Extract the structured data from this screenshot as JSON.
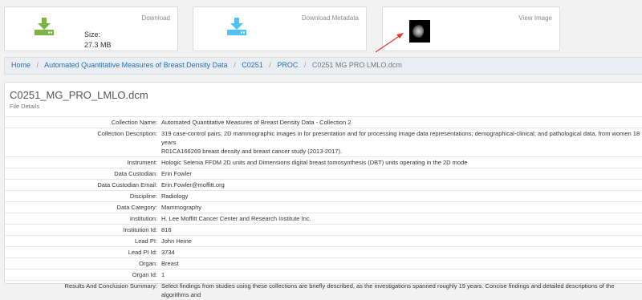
{
  "cards": {
    "download": {
      "caption": "Download",
      "size_label": "Size:",
      "size_value": "27.3 MB"
    },
    "metadata": {
      "caption": "Download Metadata"
    },
    "view": {
      "caption": "View Image"
    }
  },
  "icons": {
    "download_color": "#7cb342",
    "metadata_color": "#4fc3f7",
    "arrow_color": "#e53935"
  },
  "breadcrumb": {
    "home": "Home",
    "collection": "Automated Quantitative Measures of Breast Density Data",
    "subject": "C0251",
    "study": "PROC",
    "current": "C0251 MG PRO LMLO.dcm"
  },
  "file": {
    "title": "C0251_MG_PRO_LMLO.dcm",
    "subtitle": "File Details"
  },
  "details": [
    {
      "label": "Collection Name:",
      "value": "Automated Quantitative Measures of Breast Density Data - Collection 2"
    },
    {
      "label": "Collection Description:",
      "value": "319 case-control pairs; 2D mammographic images in for presentation and for processing image data representations; demographical-clinical; and pathological data, from women 18 years\nR01CA166269 breast density and breast cancer study (2013-2017)."
    },
    {
      "label": "Instrument:",
      "value": "Hologic Selenia FFDM 2D units and Dimensions digital breast tomosynthesis (DBT) units operating in the 2D mode"
    },
    {
      "label": "Data Custodian:",
      "value": "Erin Fowler"
    },
    {
      "label": "Data Custodian Email:",
      "value": "Erin.Fowler@moffitt.org"
    },
    {
      "label": "Discipline:",
      "value": "Radiology"
    },
    {
      "label": "Data Category:",
      "value": "Mammography"
    },
    {
      "label": "Institution:",
      "value": "H. Lee Moffitt Cancer Center and Research Institute Inc."
    },
    {
      "label": "Institution Id:",
      "value": "816"
    },
    {
      "label": "Lead PI:",
      "value": "John Heine"
    },
    {
      "label": "Lead PI Id:",
      "value": "3734"
    },
    {
      "label": "Organ:",
      "value": "Breast"
    },
    {
      "label": "Organ Id:",
      "value": "1"
    },
    {
      "label": "Results And Conclusion Summary:",
      "value": "Select findings from studies using these collections are briefly described, as the investigations spanned roughly 19 years. Concise findings and detailed descriptions of the algorithms and"
    }
  ]
}
